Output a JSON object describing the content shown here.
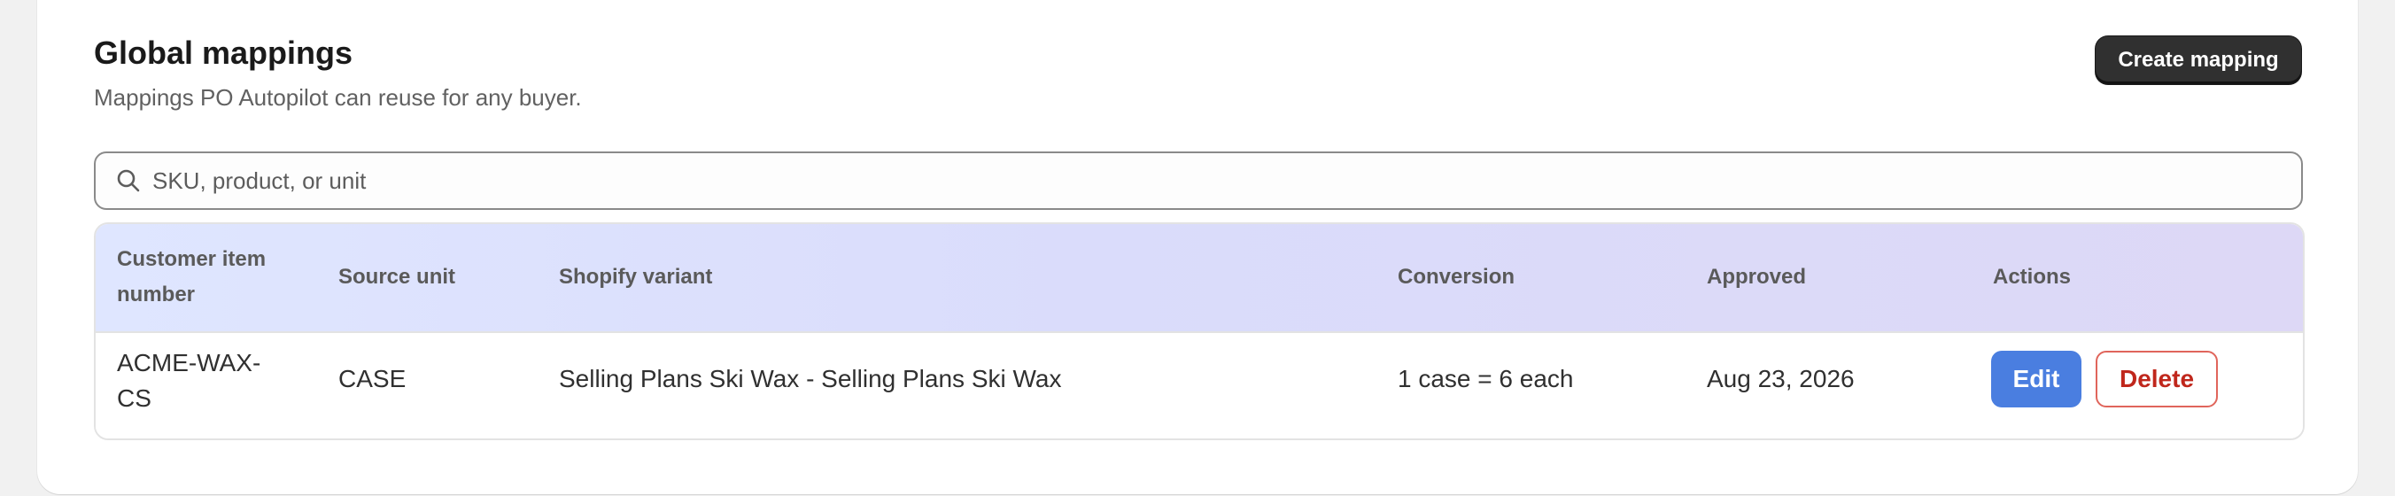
{
  "header": {
    "title": "Global mappings",
    "subtitle": "Mappings PO Autopilot can reuse for any buyer.",
    "create_button": "Create mapping"
  },
  "search": {
    "placeholder": "SKU, product, or unit",
    "value": ""
  },
  "table": {
    "columns": {
      "customer_item_number": "Customer item number",
      "source_unit": "Source unit",
      "shopify_variant": "Shopify variant",
      "conversion": "Conversion",
      "approved": "Approved",
      "actions": "Actions"
    },
    "rows": [
      {
        "customer_item_number": "ACME-WAX-CS",
        "source_unit": "CASE",
        "shopify_variant": "Selling Plans Ski Wax - Selling Plans Ski Wax",
        "conversion": "1 case = 6 each",
        "approved": "Aug 23, 2026",
        "edit_label": "Edit",
        "delete_label": "Delete"
      }
    ]
  },
  "colors": {
    "primary_dark": "#303030",
    "edit_blue": "#4a7ee0",
    "delete_red": "#c0271c",
    "header_gradient_start": "#dfe6ff",
    "header_gradient_end": "#ddd8f6"
  },
  "icons": {
    "search": "search-icon"
  }
}
